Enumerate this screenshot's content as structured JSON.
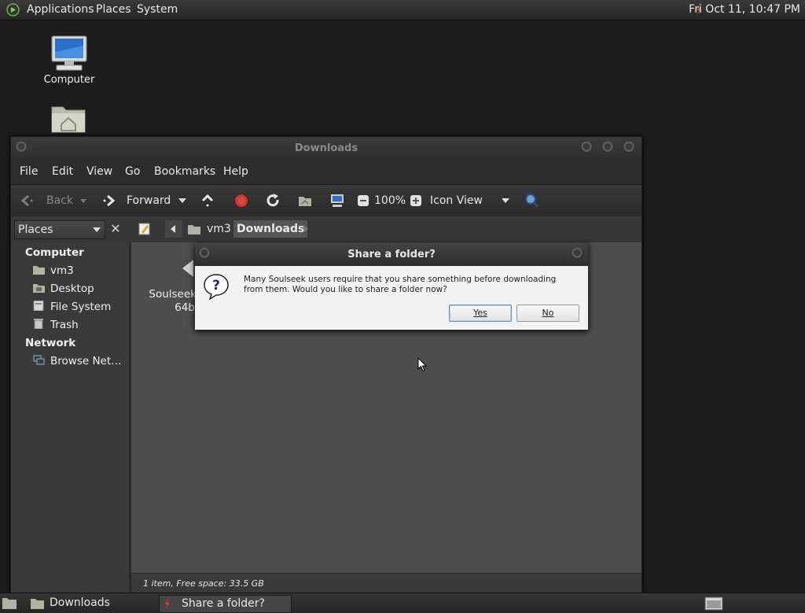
{
  "top_panel": {
    "menus": [
      "Applications",
      "Places",
      "System"
    ],
    "clock": "Fri Oct 11, 10:47 PM"
  },
  "desktop": {
    "icons": [
      {
        "label": "Computer",
        "icon": "computer-icon"
      },
      {
        "label": "",
        "icon": "home-folder-icon"
      }
    ]
  },
  "file_manager": {
    "title": "Downloads",
    "menubar": [
      "File",
      "Edit",
      "View",
      "Go",
      "Bookmarks",
      "Help"
    ],
    "toolbar": {
      "back": "Back",
      "forward": "Forward",
      "zoom": "100%",
      "view_mode": "Icon View"
    },
    "sidebar_combo": "Places",
    "breadcrumbs": [
      "vm3",
      "Downloads"
    ],
    "sidebar": {
      "sections": [
        {
          "heading": "Computer",
          "items": [
            "vm3",
            "Desktop",
            "File System",
            "Trash"
          ]
        },
        {
          "heading": "Network",
          "items": [
            "Browse Net…"
          ]
        }
      ]
    },
    "files": [
      {
        "label_line1": "SoulseekQ",
        "label_line2": "64b"
      }
    ],
    "status": "1 item, Free space: 33.5 GB"
  },
  "dialog": {
    "title": "Share a folder?",
    "message": "Many Soulseek users require that you share something before downloading from them. Would you like to share a folder now?",
    "yes_label": "Yes",
    "no_label": "No"
  },
  "taskbar": {
    "tasks": [
      "Downloads",
      "Share a folder?"
    ]
  }
}
